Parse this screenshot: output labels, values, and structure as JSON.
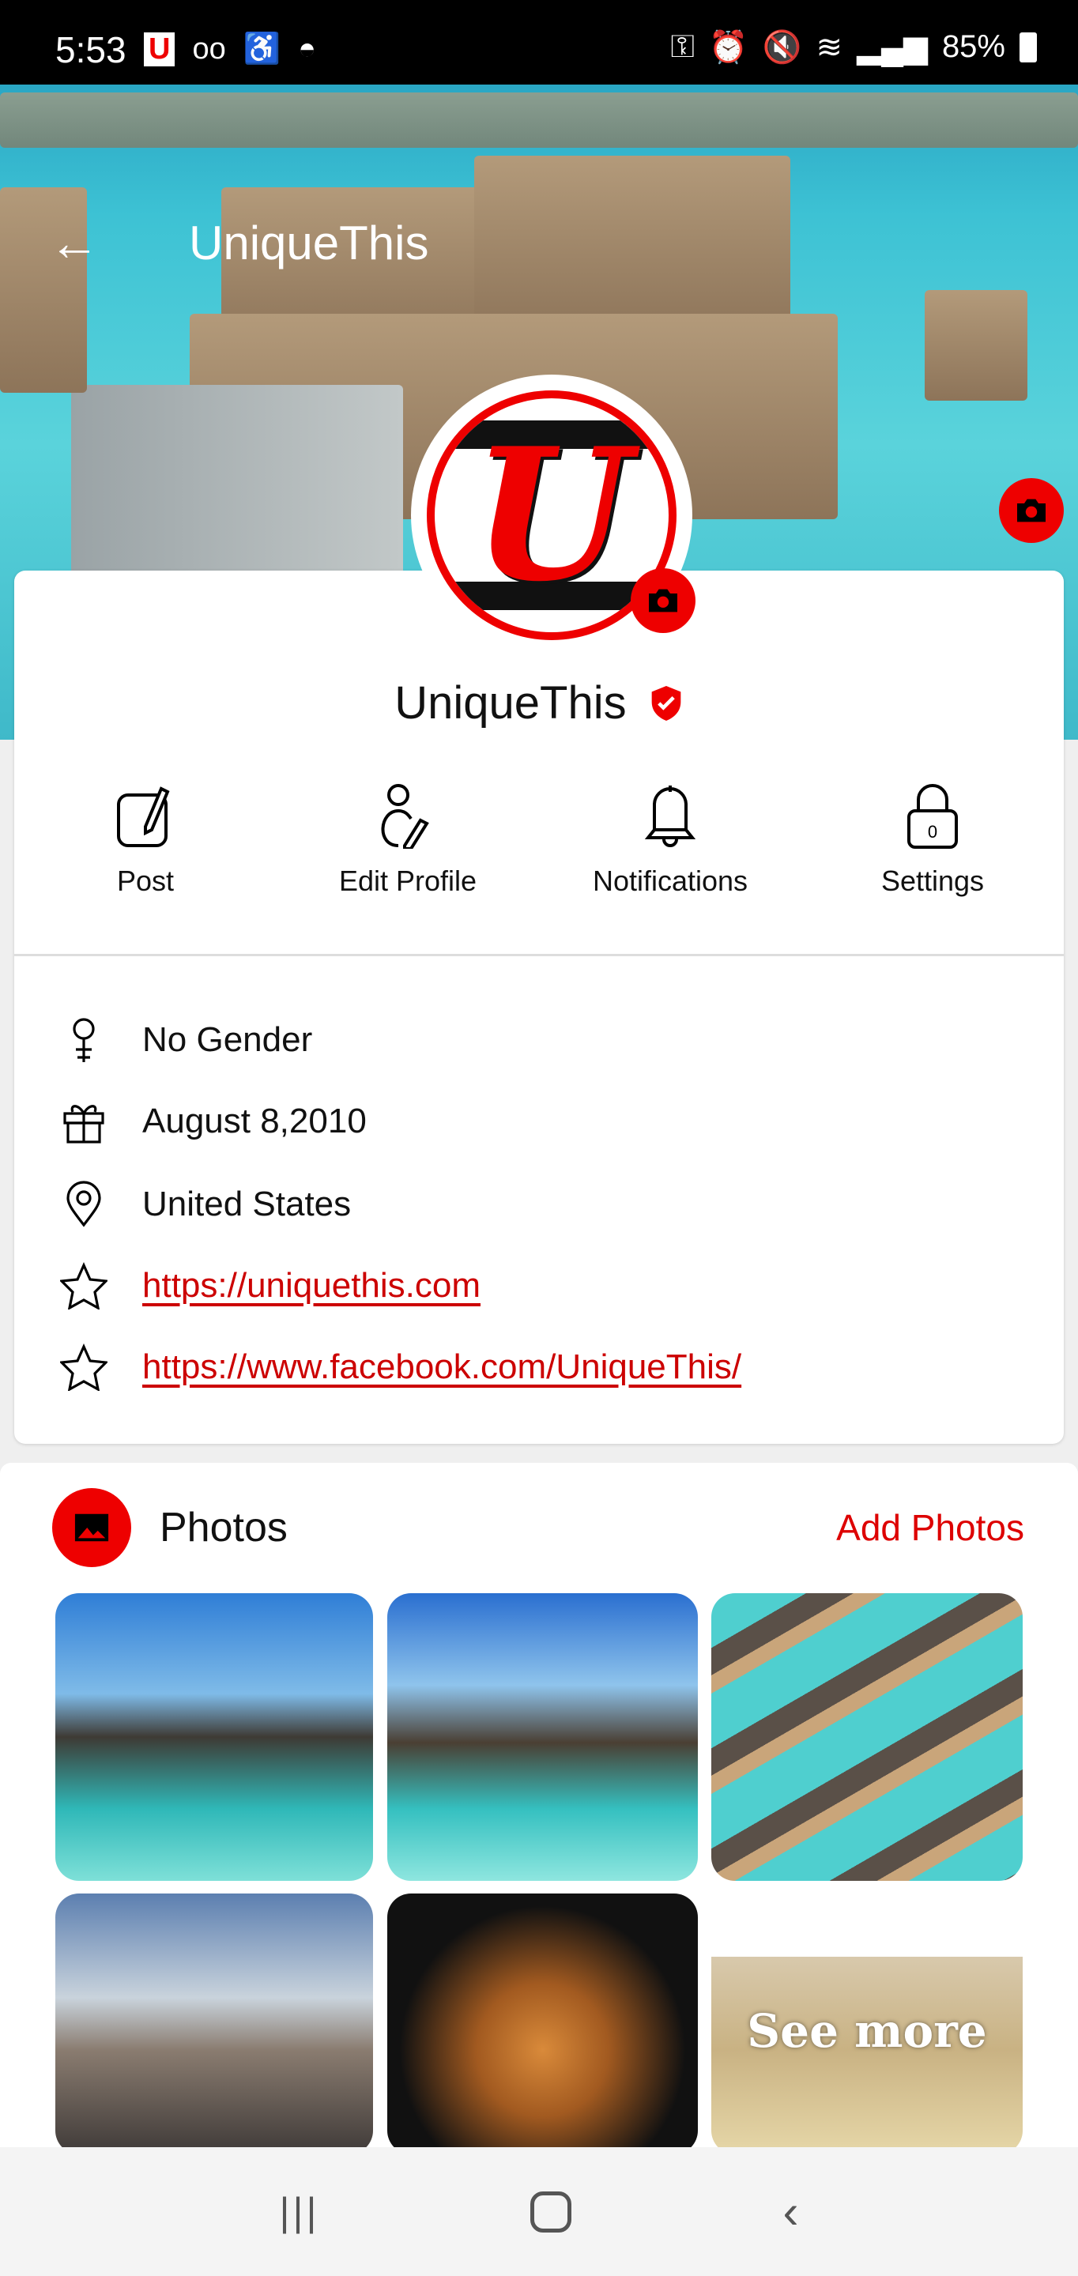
{
  "status_bar": {
    "time": "5:53",
    "battery": "85%"
  },
  "header": {
    "title": "UniqueThis"
  },
  "profile": {
    "name": "UniqueThis",
    "verified": true
  },
  "actions": [
    {
      "label": "Post",
      "icon": "edit-icon"
    },
    {
      "label": "Edit Profile",
      "icon": "user-edit-icon"
    },
    {
      "label": "Notifications",
      "icon": "bell-icon"
    },
    {
      "label": "Settings",
      "icon": "lock-icon",
      "badge": "0"
    }
  ],
  "info": {
    "gender": "No Gender",
    "birthday": "August 8,2010",
    "location": "United States",
    "links": [
      "https://uniquethis.com",
      "https://www.facebook.com/UniqueThis/"
    ]
  },
  "photos": {
    "title": "Photos",
    "add_label": "Add Photos",
    "see_more": "See more"
  },
  "colors": {
    "accent": "#e00000"
  }
}
